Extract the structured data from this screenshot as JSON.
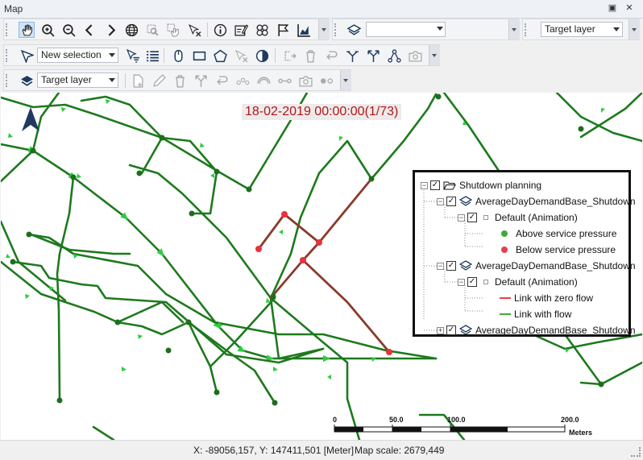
{
  "window": {
    "title": "Map",
    "pin_label": "▣",
    "close_label": "✕"
  },
  "toolbar1": {
    "icons": [
      "pan-icon",
      "zoom-in-icon",
      "zoom-out-icon",
      "back-icon",
      "forward-icon",
      "globe-icon",
      "zoom-selection-icon",
      "pan-selection-icon",
      "clear-selection-icon",
      "info-icon",
      "edit-icon",
      "flower-icon",
      "flag-icon",
      "chart-icon"
    ],
    "layer_combo_value": "",
    "target_layer_label": "Target layer"
  },
  "toolbar2": {
    "selection_mode_label": "New selection",
    "icons": [
      "select-arrow-icon",
      "filter-select-icon",
      "list-icon",
      "mouse-icon",
      "rectangle-icon",
      "pentagon-icon",
      "clear-icon",
      "contrast-icon",
      "copy-icon",
      "delete-icon",
      "undo-icon",
      "split-icon",
      "fork-icon",
      "network-icon",
      "camera-icon"
    ]
  },
  "toolbar3": {
    "target_layer_label": "Target layer",
    "icons": [
      "layers-icon",
      "new-icon",
      "pencil-icon",
      "trash-icon",
      "branch-icon",
      "rotate-icon",
      "vertex-icon",
      "bridge-icon",
      "link-icon",
      "valve-icon",
      "node-icon"
    ]
  },
  "map": {
    "timestamp": "18-02-2019 00:00:00(1/73)",
    "north_arrow": "north-arrow-icon",
    "colors": {
      "pipe": "#1d7a1d",
      "arrow": "#2ecc40",
      "shutdown": "#8b3a2b",
      "node_green": "#1e6e1e",
      "node_red": "#e8323c"
    }
  },
  "legend": {
    "root": "Shutdown planning",
    "layers": [
      {
        "name": "AverageDayDemandBase_Shutdown",
        "sub": "Default (Animation)",
        "items": [
          {
            "label": "Above service pressure",
            "color": "#3daa3d",
            "kind": "dot"
          },
          {
            "label": "Below service pressure",
            "color": "#e8404a",
            "kind": "dot"
          }
        ]
      },
      {
        "name": "AverageDayDemandBase_Shutdown",
        "sub": "Default (Animation)",
        "items": [
          {
            "label": "Link with zero flow",
            "color": "#e8404a",
            "kind": "line"
          },
          {
            "label": "Link with flow",
            "color": "#3daa3d",
            "kind": "line"
          }
        ]
      },
      {
        "name": "AverageDayDemandBase_Shutdown"
      }
    ]
  },
  "scalebar": {
    "ticks": [
      "0",
      "50.0",
      "100.0",
      "200.0"
    ],
    "unit": "Meters"
  },
  "status": {
    "coords": "X: -89056,157, Y: 147411,501 [Meter]",
    "scale": "Map scale: 2679,449"
  }
}
